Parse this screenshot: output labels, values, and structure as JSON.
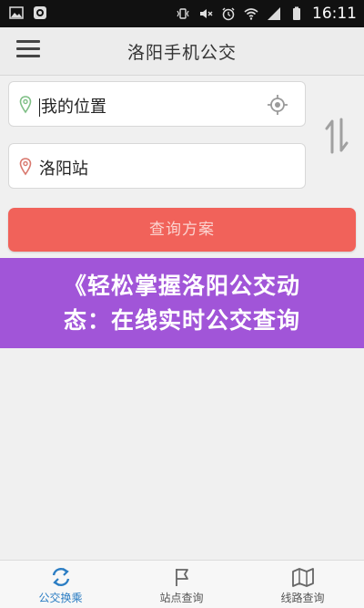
{
  "status_bar": {
    "time": "16:11",
    "left_icons": [
      "image-icon",
      "notification-icon"
    ],
    "right_icons": [
      "vibrate-icon",
      "mute-icon",
      "alarm-icon",
      "wifi-icon",
      "signal-icon",
      "battery-icon"
    ]
  },
  "app_bar": {
    "title": "洛阳手机公交",
    "menu_icon": "menu-icon"
  },
  "route_form": {
    "from_value": "我的位置",
    "to_value": "洛阳站",
    "from_icon": "location-pin-icon",
    "to_icon": "location-pin-icon",
    "locate_icon": "locate-icon",
    "swap_icon": "swap-icon",
    "query_button": "查询方案"
  },
  "colors": {
    "accent": "#f1625a",
    "active_tab": "#2b7dc3",
    "banner": "#a155d8"
  },
  "banner": {
    "line1": "《轻松掌握洛阳公交动",
    "line2": "态：在线实时公交查询"
  },
  "tabs": [
    {
      "label": "公交换乘",
      "icon": "transfer-icon",
      "active": true
    },
    {
      "label": "站点查询",
      "icon": "flag-icon",
      "active": false
    },
    {
      "label": "线路查询",
      "icon": "map-icon",
      "active": false
    }
  ]
}
